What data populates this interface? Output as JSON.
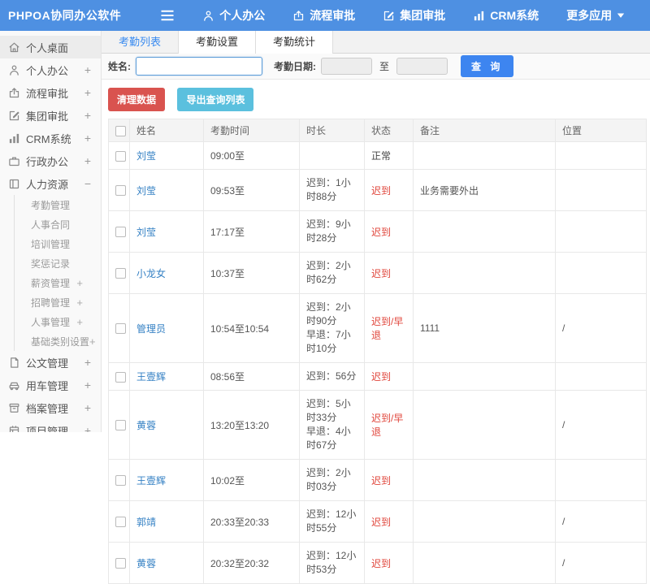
{
  "navbar": {
    "logo": "PHPOA协同办公软件",
    "items": [
      {
        "label": "个人办公",
        "icon": "person-icon"
      },
      {
        "label": "流程审批",
        "icon": "flow-icon"
      },
      {
        "label": "集团审批",
        "icon": "edit-icon"
      },
      {
        "label": "CRM系统",
        "icon": "chart-icon"
      },
      {
        "label": "更多应用",
        "icon": "caret-down-icon"
      }
    ]
  },
  "sidebar": {
    "items": [
      {
        "label": "个人桌面",
        "icon": "home-icon",
        "toggle": "",
        "active": true
      },
      {
        "label": "个人办公",
        "icon": "person-icon",
        "toggle": "+"
      },
      {
        "label": "流程审批",
        "icon": "flow-icon",
        "toggle": "+"
      },
      {
        "label": "集团审批",
        "icon": "edit-icon",
        "toggle": "+"
      },
      {
        "label": "CRM系统",
        "icon": "chart-icon",
        "toggle": "+"
      },
      {
        "label": "行政办公",
        "icon": "briefcase-icon",
        "toggle": "+"
      },
      {
        "label": "人力资源",
        "icon": "book-icon",
        "toggle": "−",
        "children": [
          {
            "label": "考勤管理",
            "toggle": ""
          },
          {
            "label": "人事合同",
            "toggle": ""
          },
          {
            "label": "培训管理",
            "toggle": ""
          },
          {
            "label": "奖惩记录",
            "toggle": ""
          },
          {
            "label": "薪资管理",
            "toggle": "+"
          },
          {
            "label": "招聘管理",
            "toggle": "+"
          },
          {
            "label": "人事管理",
            "toggle": "+"
          },
          {
            "label": "基础类别设置",
            "toggle": "+"
          }
        ]
      },
      {
        "label": "公文管理",
        "icon": "doc-icon",
        "toggle": "+"
      },
      {
        "label": "用车管理",
        "icon": "car-icon",
        "toggle": "+"
      },
      {
        "label": "档案管理",
        "icon": "archive-icon",
        "toggle": "+"
      },
      {
        "label": "项目管理",
        "icon": "project-icon",
        "toggle": "+"
      }
    ]
  },
  "tabs": [
    {
      "label": "考勤列表",
      "active": true
    },
    {
      "label": "考勤设置",
      "active": false
    },
    {
      "label": "考勤统计",
      "active": false
    }
  ],
  "filter": {
    "name_label": "姓名:",
    "name_value": "",
    "date_label": "考勤日期:",
    "date_from": "",
    "to_label": "至",
    "date_to": "",
    "search_button": "查 询"
  },
  "toolbar": {
    "clean_button": "清理数据",
    "export_button": "导出查询列表"
  },
  "table": {
    "columns": [
      "姓名",
      "考勤时间",
      "时长",
      "状态",
      "备注",
      "位置"
    ],
    "rows": [
      {
        "name": "刘莹",
        "time": "09:00至",
        "duration": [],
        "status": "正常",
        "status_type": "normal",
        "note": "",
        "location": ""
      },
      {
        "name": "刘莹",
        "time": "09:53至",
        "duration": [
          "迟到：1小时88分"
        ],
        "status": "迟到",
        "status_type": "late",
        "note": "业务需要外出",
        "location": ""
      },
      {
        "name": "刘莹",
        "time": "17:17至",
        "duration": [
          "迟到：9小时28分"
        ],
        "status": "迟到",
        "status_type": "late",
        "note": "",
        "location": ""
      },
      {
        "name": "小龙女",
        "time": "10:37至",
        "duration": [
          "迟到：2小时62分"
        ],
        "status": "迟到",
        "status_type": "late",
        "note": "",
        "location": ""
      },
      {
        "name": "管理员",
        "time": "10:54至10:54",
        "duration": [
          "迟到：2小时90分",
          "早退：7小时10分"
        ],
        "status": "迟到/早退",
        "status_type": "late",
        "note": "1111",
        "location": "/"
      },
      {
        "name": "王壹辉",
        "time": "08:56至",
        "duration": [
          "迟到：56分"
        ],
        "status": "迟到",
        "status_type": "late",
        "note": "",
        "location": ""
      },
      {
        "name": "黄蓉",
        "time": "13:20至13:20",
        "duration": [
          "迟到：5小时33分",
          "早退：4小时67分"
        ],
        "status": "迟到/早退",
        "status_type": "late",
        "note": "",
        "location": "/"
      },
      {
        "name": "王壹辉",
        "time": "10:02至",
        "duration": [
          "迟到：2小时03分"
        ],
        "status": "迟到",
        "status_type": "late",
        "note": "",
        "location": ""
      },
      {
        "name": "郭靖",
        "time": "20:33至20:33",
        "duration": [
          "迟到：12小时55分"
        ],
        "status": "迟到",
        "status_type": "late",
        "note": "",
        "location": "/"
      },
      {
        "name": "黄蓉",
        "time": "20:32至20:32",
        "duration": [
          "迟到：12小时53分"
        ],
        "status": "迟到",
        "status_type": "late",
        "note": "",
        "location": "/"
      }
    ]
  },
  "colors": {
    "navbar_bg": "#4e90e2",
    "tab_active": "#3a8bf0",
    "link": "#3581c4",
    "late": "#e0443a",
    "normal": "#444444",
    "danger_btn": "#d9534f",
    "info_btn": "#5bc0de",
    "primary_btn": "#3d85f0"
  }
}
